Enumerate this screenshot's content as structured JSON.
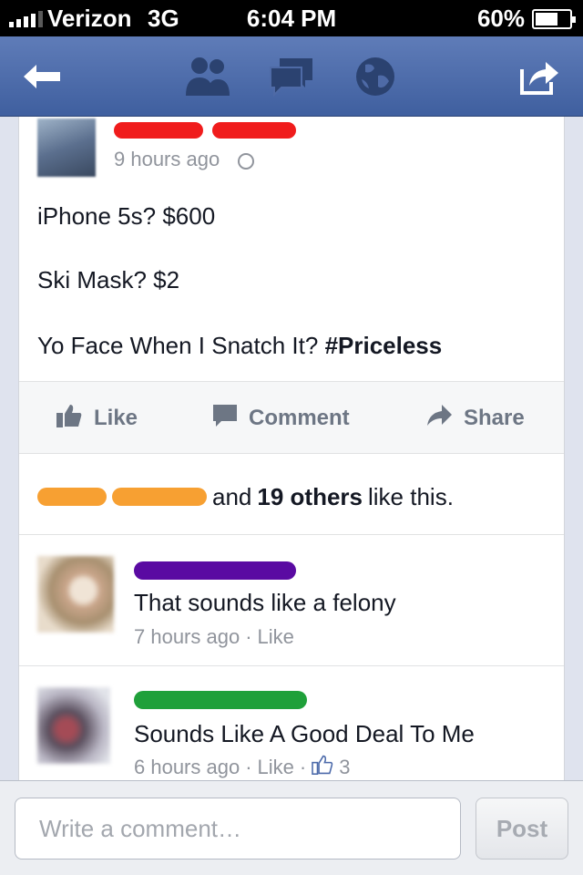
{
  "status_bar": {
    "carrier": "Verizon",
    "network": "3G",
    "time": "6:04 PM",
    "battery": "60%"
  },
  "nav": {
    "icons": [
      "back-arrow-icon",
      "friends-icon",
      "messages-icon",
      "globe-icon",
      "share-icon"
    ],
    "color": "#4c6aaa"
  },
  "post": {
    "time": "9 hours ago",
    "lines": [
      "iPhone 5s? $600",
      "Ski Mask? $2"
    ],
    "line3_prefix": "Yo Face When I Snatch It? ",
    "hashtag": "#Priceless"
  },
  "actions": {
    "like": "Like",
    "comment": "Comment",
    "share": "Share"
  },
  "likes": {
    "and": "and",
    "count_text": "19 others",
    "suffix": "like this."
  },
  "comments": [
    {
      "text": "That sounds like a felony",
      "time": "7 hours ago",
      "like_label": "Like"
    },
    {
      "text": "Sounds Like A Good Deal To Me",
      "time": "6 hours ago",
      "like_label": "Like",
      "like_count": "3"
    }
  ],
  "composer": {
    "placeholder": "Write a comment…",
    "post_label": "Post"
  }
}
